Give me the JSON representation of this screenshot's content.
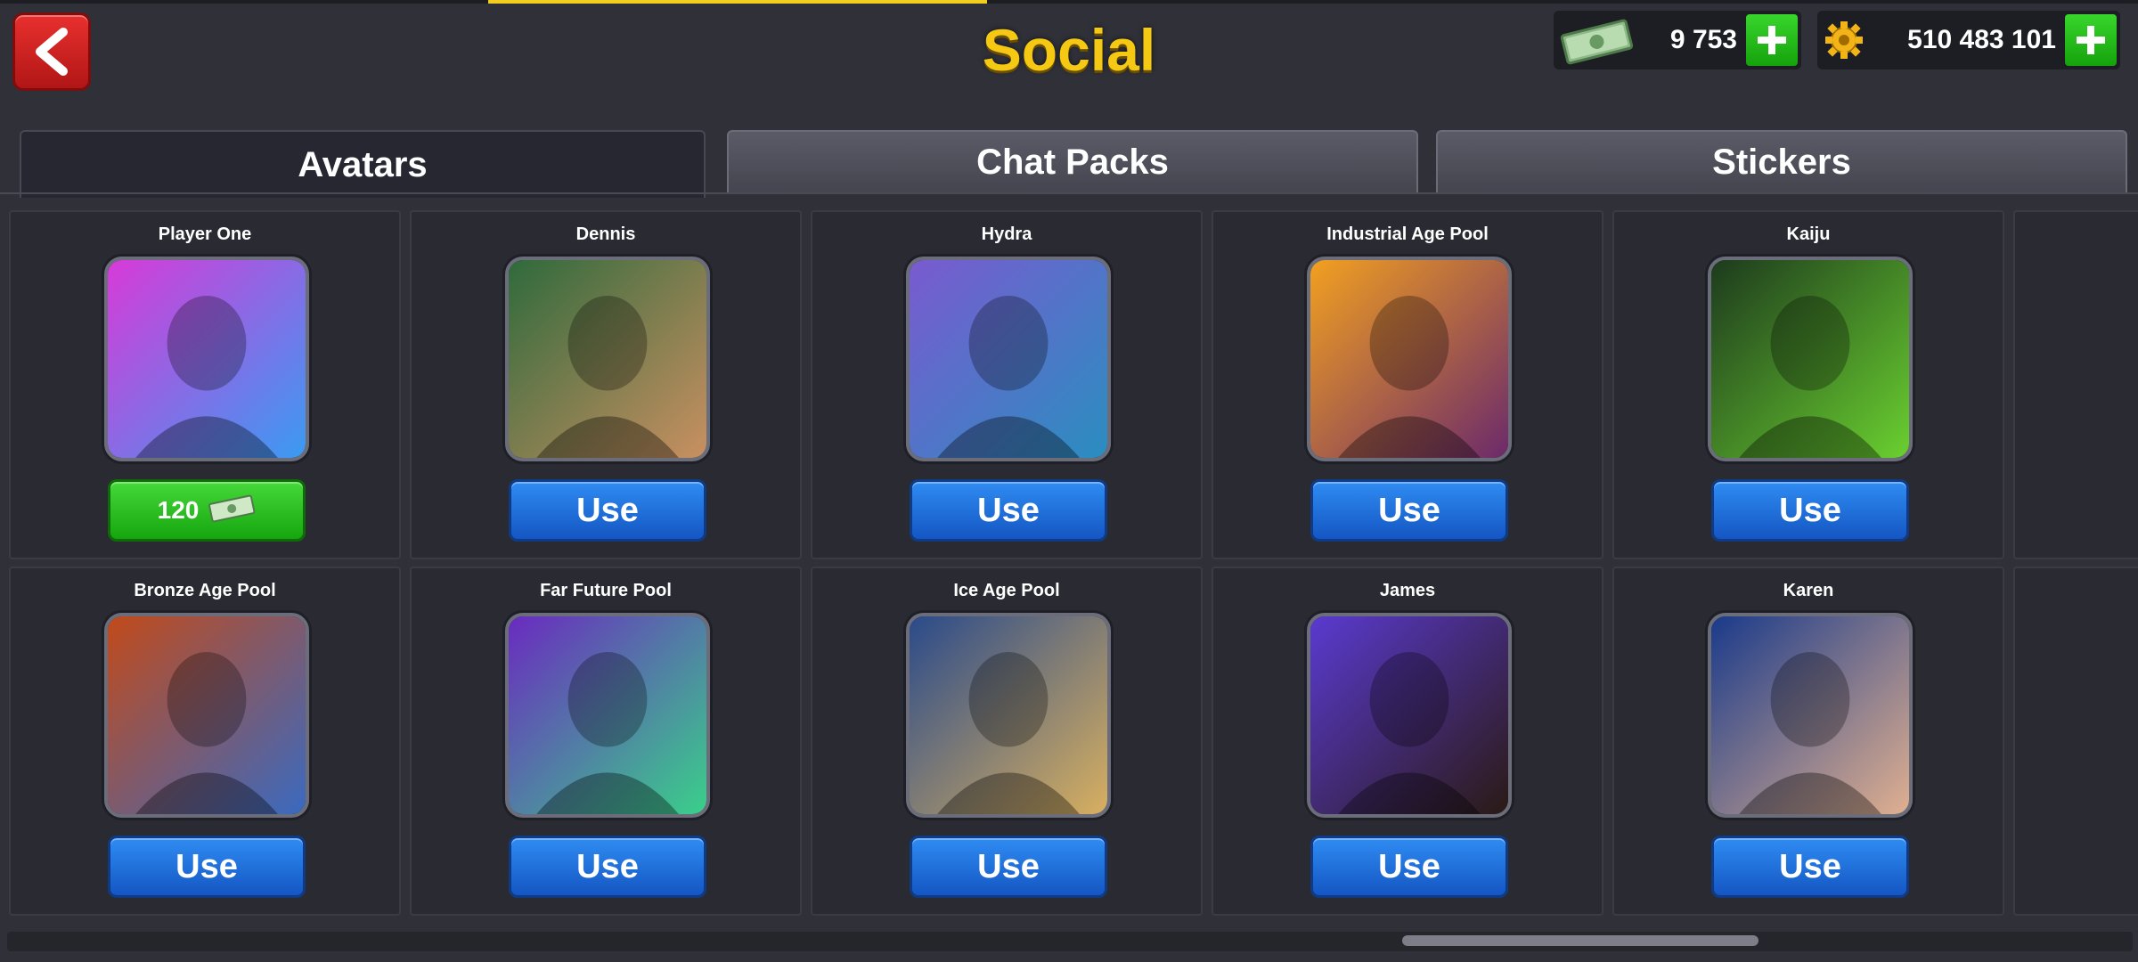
{
  "header": {
    "title": "Social",
    "back_icon": "chevron-left-icon"
  },
  "currencies": [
    {
      "name": "cash",
      "icon": "cash-bill-icon",
      "amount": "9 753"
    },
    {
      "name": "coins",
      "icon": "gear-coin-icon",
      "amount": "510 483 101"
    }
  ],
  "tabs": [
    {
      "label": "Avatars",
      "active": true
    },
    {
      "label": "Chat Packs",
      "active": false
    },
    {
      "label": "Stickers",
      "active": false
    }
  ],
  "avatars": [
    {
      "name": "Player One",
      "action": "buy",
      "price": "120",
      "colors": [
        "#d83ad8",
        "#3a9bf2"
      ]
    },
    {
      "name": "Dennis",
      "action": "use",
      "label": "Use",
      "colors": [
        "#2f6a3c",
        "#c99061"
      ]
    },
    {
      "name": "Hydra",
      "action": "use",
      "label": "Use",
      "colors": [
        "#7a5ad0",
        "#2a8ec0"
      ]
    },
    {
      "name": "Industrial Age Pool",
      "action": "use",
      "label": "Use",
      "colors": [
        "#f2a020",
        "#6b2a6a"
      ]
    },
    {
      "name": "Kaiju",
      "action": "use",
      "label": "Use",
      "colors": [
        "#1d3a1d",
        "#6ad030"
      ]
    },
    {
      "name": "Bronze Age Pool",
      "action": "use",
      "label": "Use",
      "colors": [
        "#c24a1a",
        "#3a6ac0"
      ]
    },
    {
      "name": "Far Future Pool",
      "action": "use",
      "label": "Use",
      "colors": [
        "#6a2ac0",
        "#3ad08a"
      ]
    },
    {
      "name": "Ice Age Pool",
      "action": "use",
      "label": "Use",
      "colors": [
        "#2a4a8a",
        "#d8b060"
      ]
    },
    {
      "name": "James",
      "action": "use",
      "label": "Use",
      "colors": [
        "#5a3ad0",
        "#2a1a14"
      ]
    },
    {
      "name": "Karen",
      "action": "use",
      "label": "Use",
      "colors": [
        "#1a3a8a",
        "#e0b090"
      ]
    }
  ],
  "colors": {
    "title": "#f5c814",
    "use_button": "#1f6fd8",
    "buy_button": "#22b81a",
    "back_button": "#d62222"
  }
}
